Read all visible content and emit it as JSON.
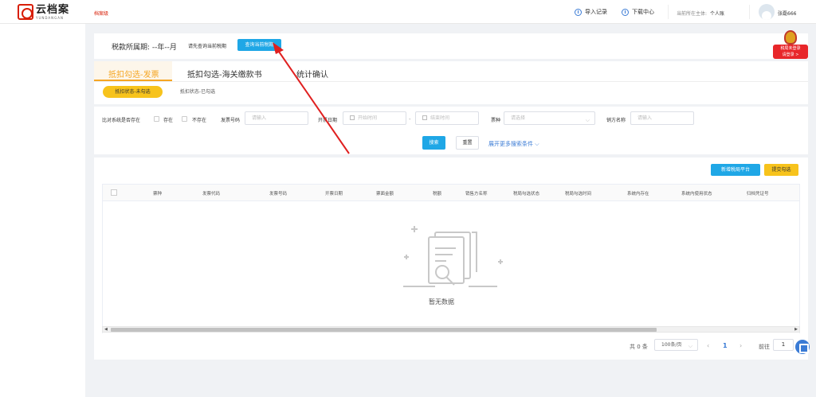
{
  "header": {
    "logo_cn": "云档案",
    "logo_en": "YUNDANGAN",
    "link": "档案级",
    "import_record": "导入记录",
    "download_center": "下载中心",
    "entity_label": "当前所在主体:",
    "entity_value": "个人账",
    "username": "张磊666"
  },
  "period": {
    "label": "税款所属期: --年--月",
    "hint": "请先查询当前税期",
    "query_button": "查询当前税期"
  },
  "badge": {
    "line1": "税局未登录",
    "line2": "请登录 >"
  },
  "tabs": [
    {
      "label": "抵扣勾选-发票"
    },
    {
      "label": "抵扣勾选-海关缴款书"
    },
    {
      "label": "统计确认"
    }
  ],
  "subtabs": [
    {
      "label": "抵扣状态-未勾选"
    },
    {
      "label": "抵扣状态-已勾选"
    }
  ],
  "filter": {
    "compare_label": "比对系统是否存在",
    "opt_exist": "存在",
    "opt_not_exist": "不存在",
    "invoice_no_label": "发票号码",
    "invoice_no_placeholder": "请输入",
    "date_label": "开票日期",
    "date_start_placeholder": "开始时间",
    "date_end_placeholder": "结束时间",
    "type_label": "票种",
    "type_placeholder": "请选择",
    "seller_label": "销方名称",
    "seller_placeholder": "请输入",
    "search_button": "搜索",
    "reset_button": "重置",
    "more_link": "展开更多搜索条件 ⌵"
  },
  "table": {
    "new_platform_button": "新增税局平台",
    "submit_button": "提交勾选",
    "columns": [
      "票种",
      "发票代码",
      "发票号码",
      "开票日期",
      "票面金额",
      "税额",
      "销售方名称",
      "税局勾选状态",
      "税局勾选时间",
      "系统内存在",
      "系统内使用状态",
      "归档凭证号"
    ],
    "empty_text": "暂无数据"
  },
  "pagination": {
    "total": "共 0 条",
    "page_size": "100条/页",
    "current_page": "1",
    "goto_label": "前往",
    "goto_value": "1"
  }
}
